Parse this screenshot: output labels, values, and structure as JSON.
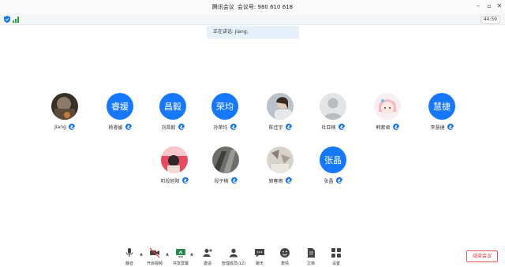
{
  "window": {
    "app_name": "腾讯会议",
    "meeting_label": "会议号:",
    "meeting_id": "980 610 618",
    "controls": [
      "minimize-icon",
      "restore-icon",
      "close-icon"
    ]
  },
  "status": {
    "timer": "44:59",
    "icons": [
      "shield-icon",
      "signal-icon"
    ]
  },
  "banner": {
    "speaking": "正在讲话: Jiang;"
  },
  "participants": [
    {
      "name": "Jiang",
      "avatar_type": "photo",
      "avatar_icon": "photo-dark-icon"
    },
    {
      "name": "杨睿媛",
      "avatar_type": "text",
      "avatar_text": "睿媛"
    },
    {
      "name": "刘昌毅",
      "avatar_type": "text",
      "avatar_text": "昌毅"
    },
    {
      "name": "孙荣均",
      "avatar_type": "text",
      "avatar_text": "荣均"
    },
    {
      "name": "陈佳宇",
      "avatar_type": "photo",
      "avatar_icon": "photo-person-icon"
    },
    {
      "name": "杜亚楠",
      "avatar_type": "photo",
      "avatar_icon": "default-user-icon"
    },
    {
      "name": "韩紫君",
      "avatar_type": "photo",
      "avatar_icon": "photo-cartoon-icon"
    },
    {
      "name": "李慧捷",
      "avatar_type": "text",
      "avatar_text": "慧捷"
    },
    {
      "name": "叩段旭阳",
      "avatar_type": "photo",
      "avatar_icon": "photo-pink-icon"
    },
    {
      "name": "段子楠",
      "avatar_type": "photo",
      "avatar_icon": "photo-grey-icon"
    },
    {
      "name": "郭春雨",
      "avatar_type": "photo",
      "avatar_icon": "photo-light-icon"
    },
    {
      "name": "张晶",
      "avatar_type": "text",
      "avatar_text": "张晶"
    }
  ],
  "toolbar": {
    "mute": "静音",
    "video": "开启视频",
    "share": "共享屏幕",
    "invite": "邀请",
    "members": "管理成员(12)",
    "chat": "聊天",
    "reactions": "表情",
    "docs": "文档",
    "settings": "设置",
    "end": "结束会议"
  },
  "colors": {
    "accent": "#1677ff",
    "end": "#e33333",
    "banner_bg": "#e6f0fb"
  }
}
